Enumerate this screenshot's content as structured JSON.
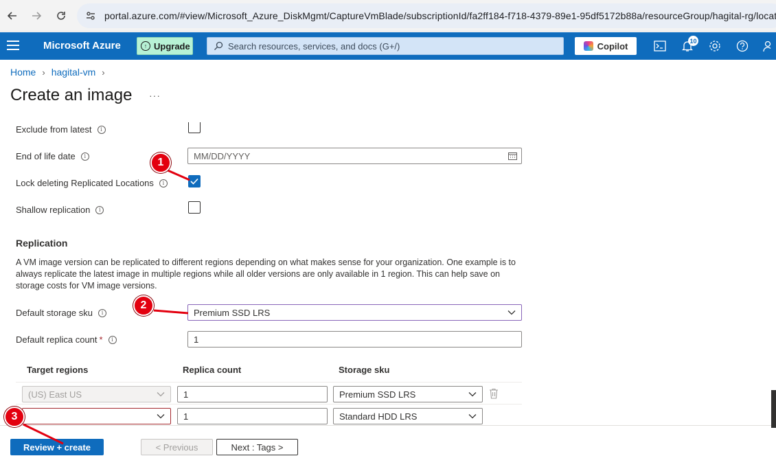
{
  "browser": {
    "url": "portal.azure.com/#view/Microsoft_Azure_DiskMgmt/CaptureVmBlade/subscriptionId/fa2ff184-f718-4379-89e1-95df5172b88a/resourceGroup/hagital-rg/locatio"
  },
  "header": {
    "title": "Microsoft Azure",
    "upgrade_label": "Upgrade",
    "search_placeholder": "Search resources, services, and docs (G+/)",
    "copilot_label": "Copilot",
    "notification_count": "10",
    "brand_color": "#0f6cbd"
  },
  "breadcrumb": [
    "Home",
    "hagital-vm"
  ],
  "page": {
    "title": "Create an image",
    "more_label": "···"
  },
  "form": {
    "exclude_from_latest": {
      "label": "Exclude from latest",
      "checked": false
    },
    "end_of_life_date": {
      "label": "End of life date",
      "placeholder": "MM/DD/YYYY"
    },
    "lock_deleting": {
      "label": "Lock deleting Replicated Locations",
      "checked": true
    },
    "shallow_replication": {
      "label": "Shallow replication",
      "checked": false
    }
  },
  "replication": {
    "title": "Replication",
    "description": "A VM image version can be replicated to different regions depending on what makes sense for your organization. One example is to always replicate the latest image in multiple regions while all older versions are only available in 1 region. This can help save on storage costs for VM image versions.",
    "default_storage_sku": {
      "label": "Default storage sku",
      "value": "Premium SSD LRS"
    },
    "default_replica_count": {
      "label": "Default replica count",
      "required_mark": "*",
      "value": "1"
    },
    "table": {
      "headers": [
        "Target regions",
        "Replica count",
        "Storage sku"
      ],
      "rows": [
        {
          "region": "(US) East US",
          "replica_count": "1",
          "storage_sku": "Premium SSD LRS"
        },
        {
          "region": "",
          "replica_count": "1",
          "storage_sku": "Standard HDD LRS"
        }
      ]
    }
  },
  "footer": {
    "review_label": "Review + create",
    "previous_label": "< Previous",
    "next_label": "Next : Tags >"
  },
  "callouts": [
    "1",
    "2",
    "3"
  ]
}
